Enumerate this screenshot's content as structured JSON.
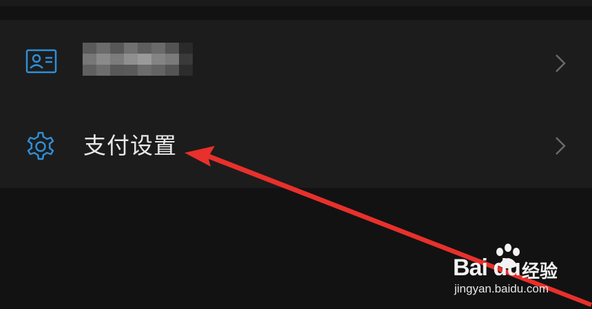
{
  "menu": {
    "items": [
      {
        "icon": "id-card-icon",
        "label": "",
        "redacted": true
      },
      {
        "icon": "gear-icon",
        "label": "支付设置"
      }
    ]
  },
  "watermark": {
    "brand": "Bai du",
    "product": "经验",
    "url": "jingyan.baidu.com"
  },
  "colors": {
    "background": "#121212",
    "card": "#1c1c1c",
    "icon_accent": "#2f8fd8",
    "chevron": "#6a6a6a",
    "annotation_arrow": "#e8302c"
  }
}
